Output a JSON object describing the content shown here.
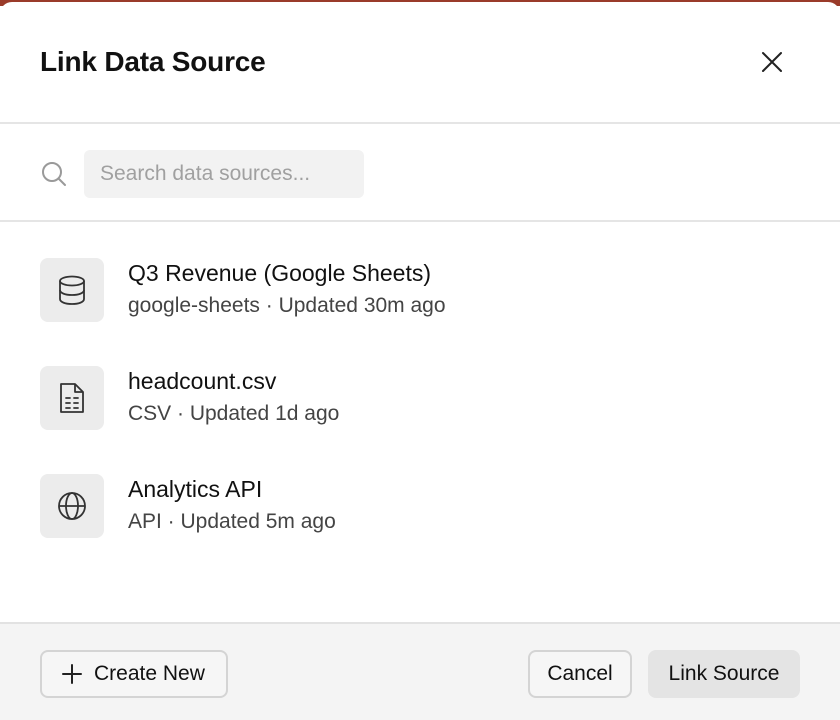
{
  "dialog": {
    "title": "Link Data Source"
  },
  "search": {
    "placeholder": "Search data sources...",
    "value": ""
  },
  "sources": [
    {
      "name": "Q3 Revenue (Google Sheets)",
      "meta": "google-sheets · Updated 30m ago",
      "icon": "database-icon"
    },
    {
      "name": "headcount.csv",
      "meta": "CSV · Updated 1d ago",
      "icon": "spreadsheet-file-icon"
    },
    {
      "name": "Analytics API",
      "meta": "API · Updated 5m ago",
      "icon": "globe-icon"
    }
  ],
  "footer": {
    "create_label": "Create New",
    "cancel_label": "Cancel",
    "link_label": "Link Source"
  }
}
